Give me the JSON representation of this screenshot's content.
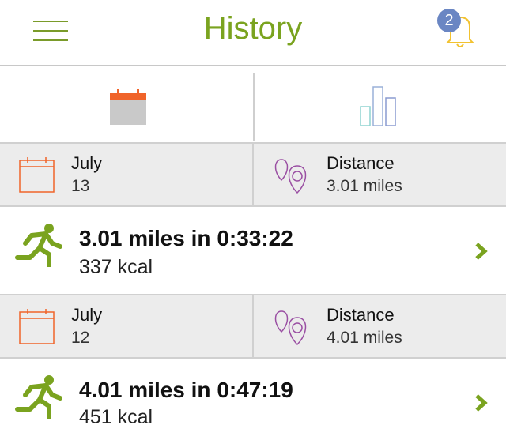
{
  "header": {
    "title": "History",
    "notification_count": "2"
  },
  "colors": {
    "brand_green": "#7aa31f",
    "accent_orange": "#f0642a",
    "accent_purple": "#9a4fa3",
    "badge_blue": "#6a86c3"
  },
  "tabs": [
    {
      "name": "calendar",
      "icon": "calendar-icon",
      "selected": true
    },
    {
      "name": "statistics",
      "icon": "bar-chart-icon",
      "selected": false
    }
  ],
  "entries": [
    {
      "month": "July",
      "day": "13",
      "metric_label": "Distance",
      "metric_value": "3.01 miles",
      "summary": "3.01 miles in 0:33:22",
      "calories": "337 kcal"
    },
    {
      "month": "July",
      "day": "12",
      "metric_label": "Distance",
      "metric_value": "4.01 miles",
      "summary": "4.01 miles in 0:47:19",
      "calories": "451 kcal"
    }
  ]
}
